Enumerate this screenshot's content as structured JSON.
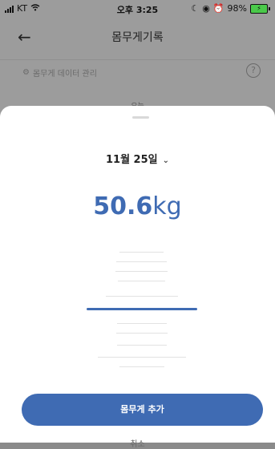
{
  "status_bar": {
    "carrier": "KT",
    "time": "오후 3:25",
    "battery": "98%"
  },
  "header": {
    "title": "몸무게기록",
    "back_icon": "arrow-left-icon"
  },
  "manage": {
    "label": "몸무게 데이터 관리",
    "help_icon": "question-circle-icon"
  },
  "peek": {
    "text": "오늘"
  },
  "sheet": {
    "date": "11월 25일",
    "weight_value": "50.6",
    "weight_unit": "kg",
    "add_button": "몸무게 추가",
    "cancel": "취소"
  },
  "colors": {
    "accent": "#3f6bb3",
    "overlay": "#9c9c9c"
  }
}
